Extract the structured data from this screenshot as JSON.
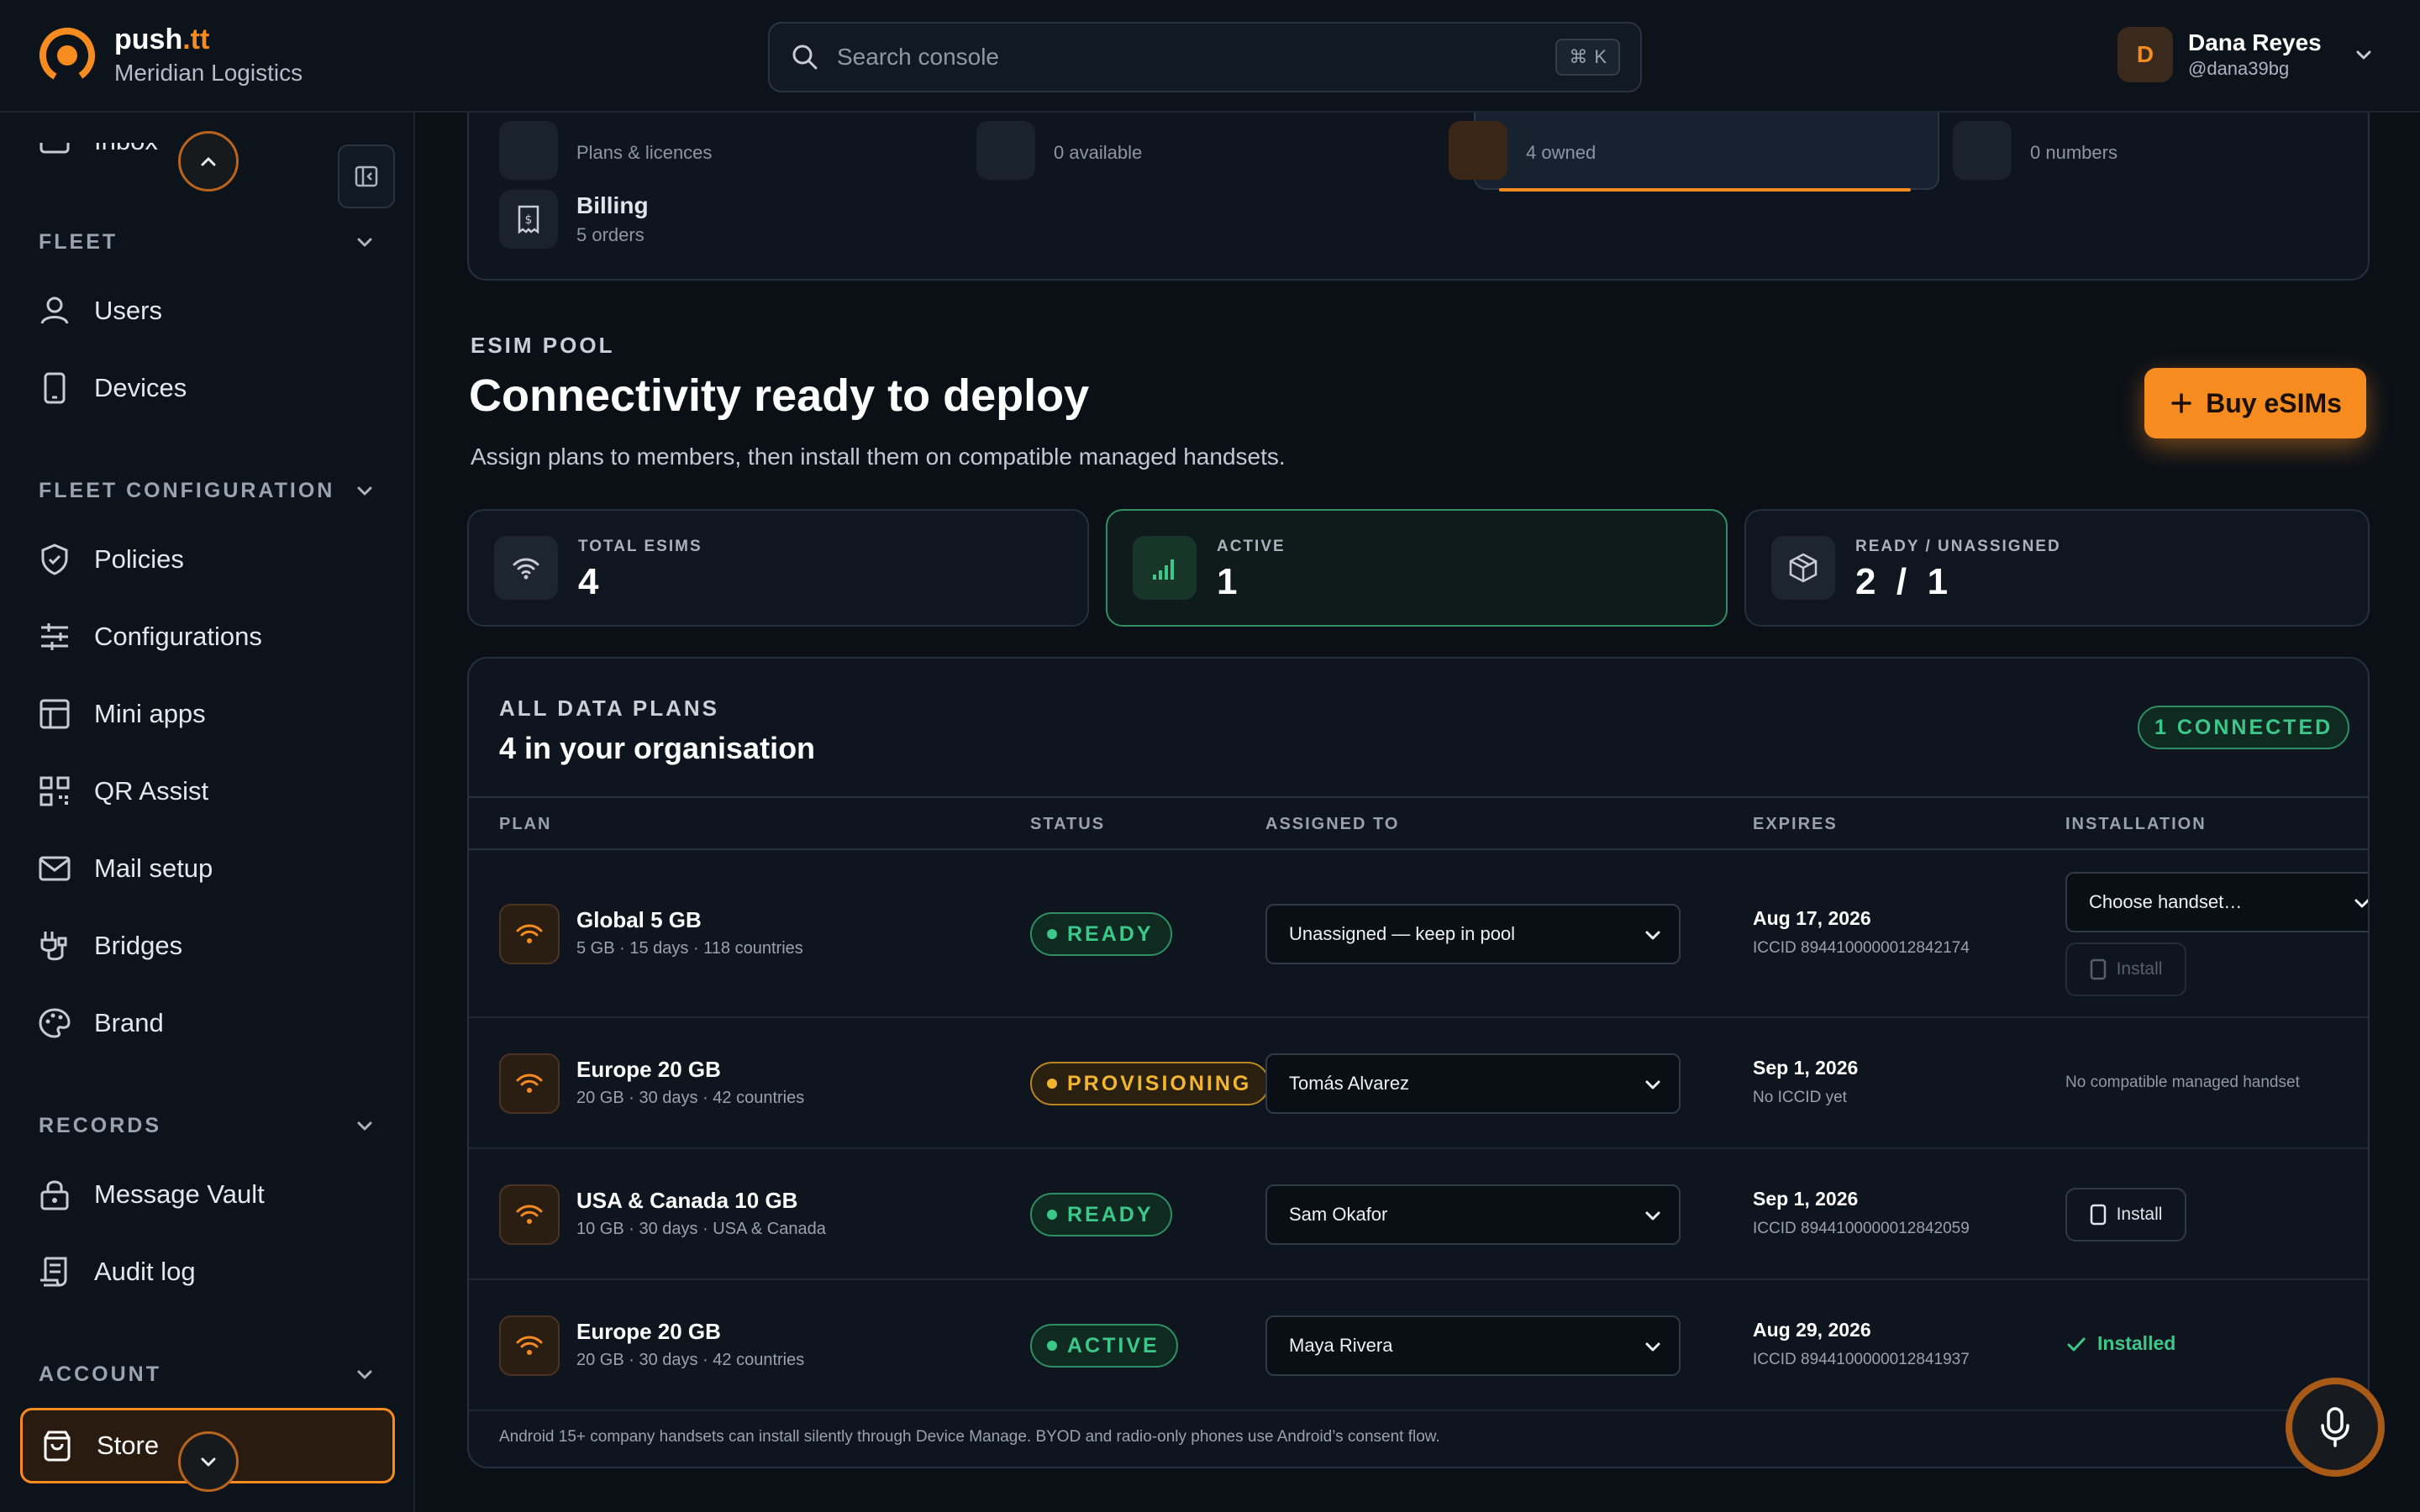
{
  "brand": {
    "name_main": "push",
    "name_accent": ".tt",
    "org": "Meridian Logistics",
    "accent_color": "#f68b1f"
  },
  "search": {
    "placeholder": "Search console",
    "shortcut_symbol": "⌘",
    "shortcut_key": "K"
  },
  "user": {
    "initial": "D",
    "name": "Dana Reyes",
    "handle": "@dana39bg"
  },
  "sidebar": {
    "partial_top_item": "Inbox",
    "sections": [
      {
        "label": "FLEET",
        "items": [
          "Users",
          "Devices"
        ]
      },
      {
        "label": "FLEET CONFIGURATION",
        "items": [
          "Policies",
          "Configurations",
          "Mini apps",
          "QR Assist",
          "Mail setup",
          "Bridges",
          "Brand"
        ]
      },
      {
        "label": "RECORDS",
        "items": [
          "Message Vault",
          "Audit log"
        ]
      },
      {
        "label": "ACCOUNT",
        "items": [
          "Store"
        ]
      }
    ],
    "active_item": "Store"
  },
  "store_tabs": [
    {
      "title": "",
      "sub": "Plans & licences"
    },
    {
      "title": "",
      "sub": "0 available"
    },
    {
      "title": "",
      "sub": "4 owned"
    },
    {
      "title": "",
      "sub": "0 numbers"
    },
    {
      "title": "Billing",
      "sub": "5 orders"
    }
  ],
  "header": {
    "eyebrow": "ESIM POOL",
    "title": "Connectivity ready to deploy",
    "subtitle": "Assign plans to members, then install them on compatible managed handsets.",
    "buy_button": "Buy eSIMs"
  },
  "stats": [
    {
      "label": "TOTAL ESIMS",
      "value": "4"
    },
    {
      "label": "ACTIVE",
      "value": "1"
    },
    {
      "label": "READY / UNASSIGNED",
      "value": "2  /  1"
    }
  ],
  "plans": {
    "eyebrow": "ALL DATA PLANS",
    "title": "4 in your organisation",
    "connected_badge": "1 CONNECTED",
    "columns": [
      "PLAN",
      "STATUS",
      "ASSIGNED TO",
      "EXPIRES",
      "INSTALLATION"
    ],
    "rows": [
      {
        "name": "Global 5 GB",
        "meta": "5 GB · 15 days · 118 countries",
        "status": "READY",
        "assigned": "Unassigned — keep in pool",
        "expires": "Aug 17, 2026",
        "iccid": "ICCID 8944100000012842174",
        "handset_placeholder": "Choose handset…",
        "install_label": "Install"
      },
      {
        "name": "Europe 20 GB",
        "meta": "20 GB · 30 days · 42 countries",
        "status": "PROVISIONING",
        "assigned": "Tomás Alvarez",
        "expires": "Sep 1, 2026",
        "iccid": "No ICCID yet",
        "installation_text": "No compatible managed handset"
      },
      {
        "name": "USA & Canada 10 GB",
        "meta": "10 GB · 30 days · USA & Canada",
        "status": "READY",
        "assigned": "Sam Okafor",
        "expires": "Sep 1, 2026",
        "iccid": "ICCID 8944100000012842059",
        "install_label": "Install"
      },
      {
        "name": "Europe 20 GB",
        "meta": "20 GB · 30 days · 42 countries",
        "status": "ACTIVE",
        "assigned": "Maya Rivera",
        "expires": "Aug 29, 2026",
        "iccid": "ICCID 8944100000012841937",
        "installation_text": "Installed"
      }
    ],
    "footnote": "Android 15+ company handsets can install silently through Device Manage. BYOD and radio-only phones use Android’s consent flow."
  },
  "colors": {
    "ready": "#3cc889",
    "provisioning": "#f2b52f",
    "accent": "#f68b1f"
  }
}
